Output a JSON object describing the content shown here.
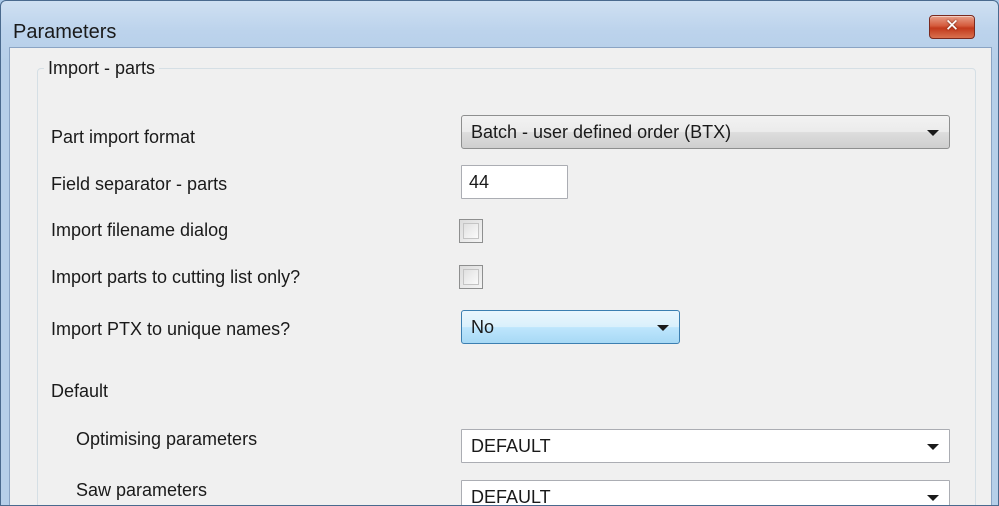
{
  "window": {
    "title": "Parameters",
    "close_glyph": "✕"
  },
  "group": {
    "legend": "Import - parts"
  },
  "fields": {
    "part_import_format": {
      "label": "Part import format",
      "value": "Batch - user defined order (BTX)"
    },
    "field_separator": {
      "label": "Field separator - parts",
      "value": "44"
    },
    "import_filename_dialog": {
      "label": "Import filename dialog",
      "checked": false
    },
    "import_cutting_list_only": {
      "label": "Import parts to cutting list only?",
      "checked": false
    },
    "import_ptx_unique": {
      "label": "Import PTX to unique names?",
      "value": "No"
    }
  },
  "defaults": {
    "heading": "Default",
    "optimising": {
      "label": "Optimising parameters",
      "value": "DEFAULT"
    },
    "saw": {
      "label": "Saw parameters",
      "value": "DEFAULT"
    }
  }
}
